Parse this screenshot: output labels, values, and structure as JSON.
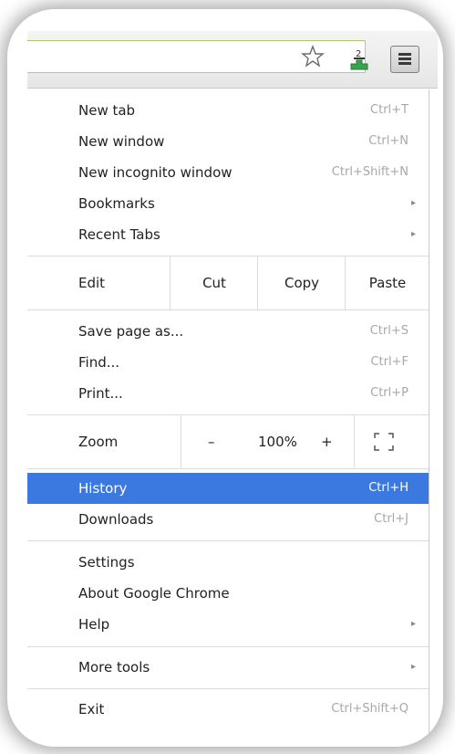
{
  "toolbar": {
    "badge_count": "2",
    "star_icon": "star-icon",
    "menu_icon": "hamburger-menu-icon"
  },
  "menu": {
    "group1": [
      {
        "label": "New tab",
        "shortcut": "Ctrl+T"
      },
      {
        "label": "New window",
        "shortcut": "Ctrl+N"
      },
      {
        "label": "New incognito window",
        "shortcut": "Ctrl+Shift+N"
      },
      {
        "label": "Bookmarks",
        "submenu": true
      },
      {
        "label": "Recent Tabs",
        "submenu": true
      }
    ],
    "edit": {
      "label": "Edit",
      "cut": "Cut",
      "copy": "Copy",
      "paste": "Paste"
    },
    "group2": [
      {
        "label": "Save page as...",
        "shortcut": "Ctrl+S"
      },
      {
        "label": "Find...",
        "shortcut": "Ctrl+F"
      },
      {
        "label": "Print...",
        "shortcut": "Ctrl+P"
      }
    ],
    "zoom": {
      "label": "Zoom",
      "minus": "–",
      "value": "100%",
      "plus": "+"
    },
    "group3": [
      {
        "label": "History",
        "shortcut": "Ctrl+H",
        "highlighted": true
      },
      {
        "label": "Downloads",
        "shortcut": "Ctrl+J"
      }
    ],
    "group4": [
      {
        "label": "Settings"
      },
      {
        "label": "About Google Chrome"
      },
      {
        "label": "Help",
        "submenu": true
      }
    ],
    "more_tools": {
      "label": "More tools",
      "submenu": true
    },
    "exit": {
      "label": "Exit",
      "shortcut": "Ctrl+Shift+Q"
    },
    "submenu_arrow": "▸"
  },
  "colors": {
    "highlight": "#3b78e0",
    "shortcut_text": "#a8a8a8"
  }
}
